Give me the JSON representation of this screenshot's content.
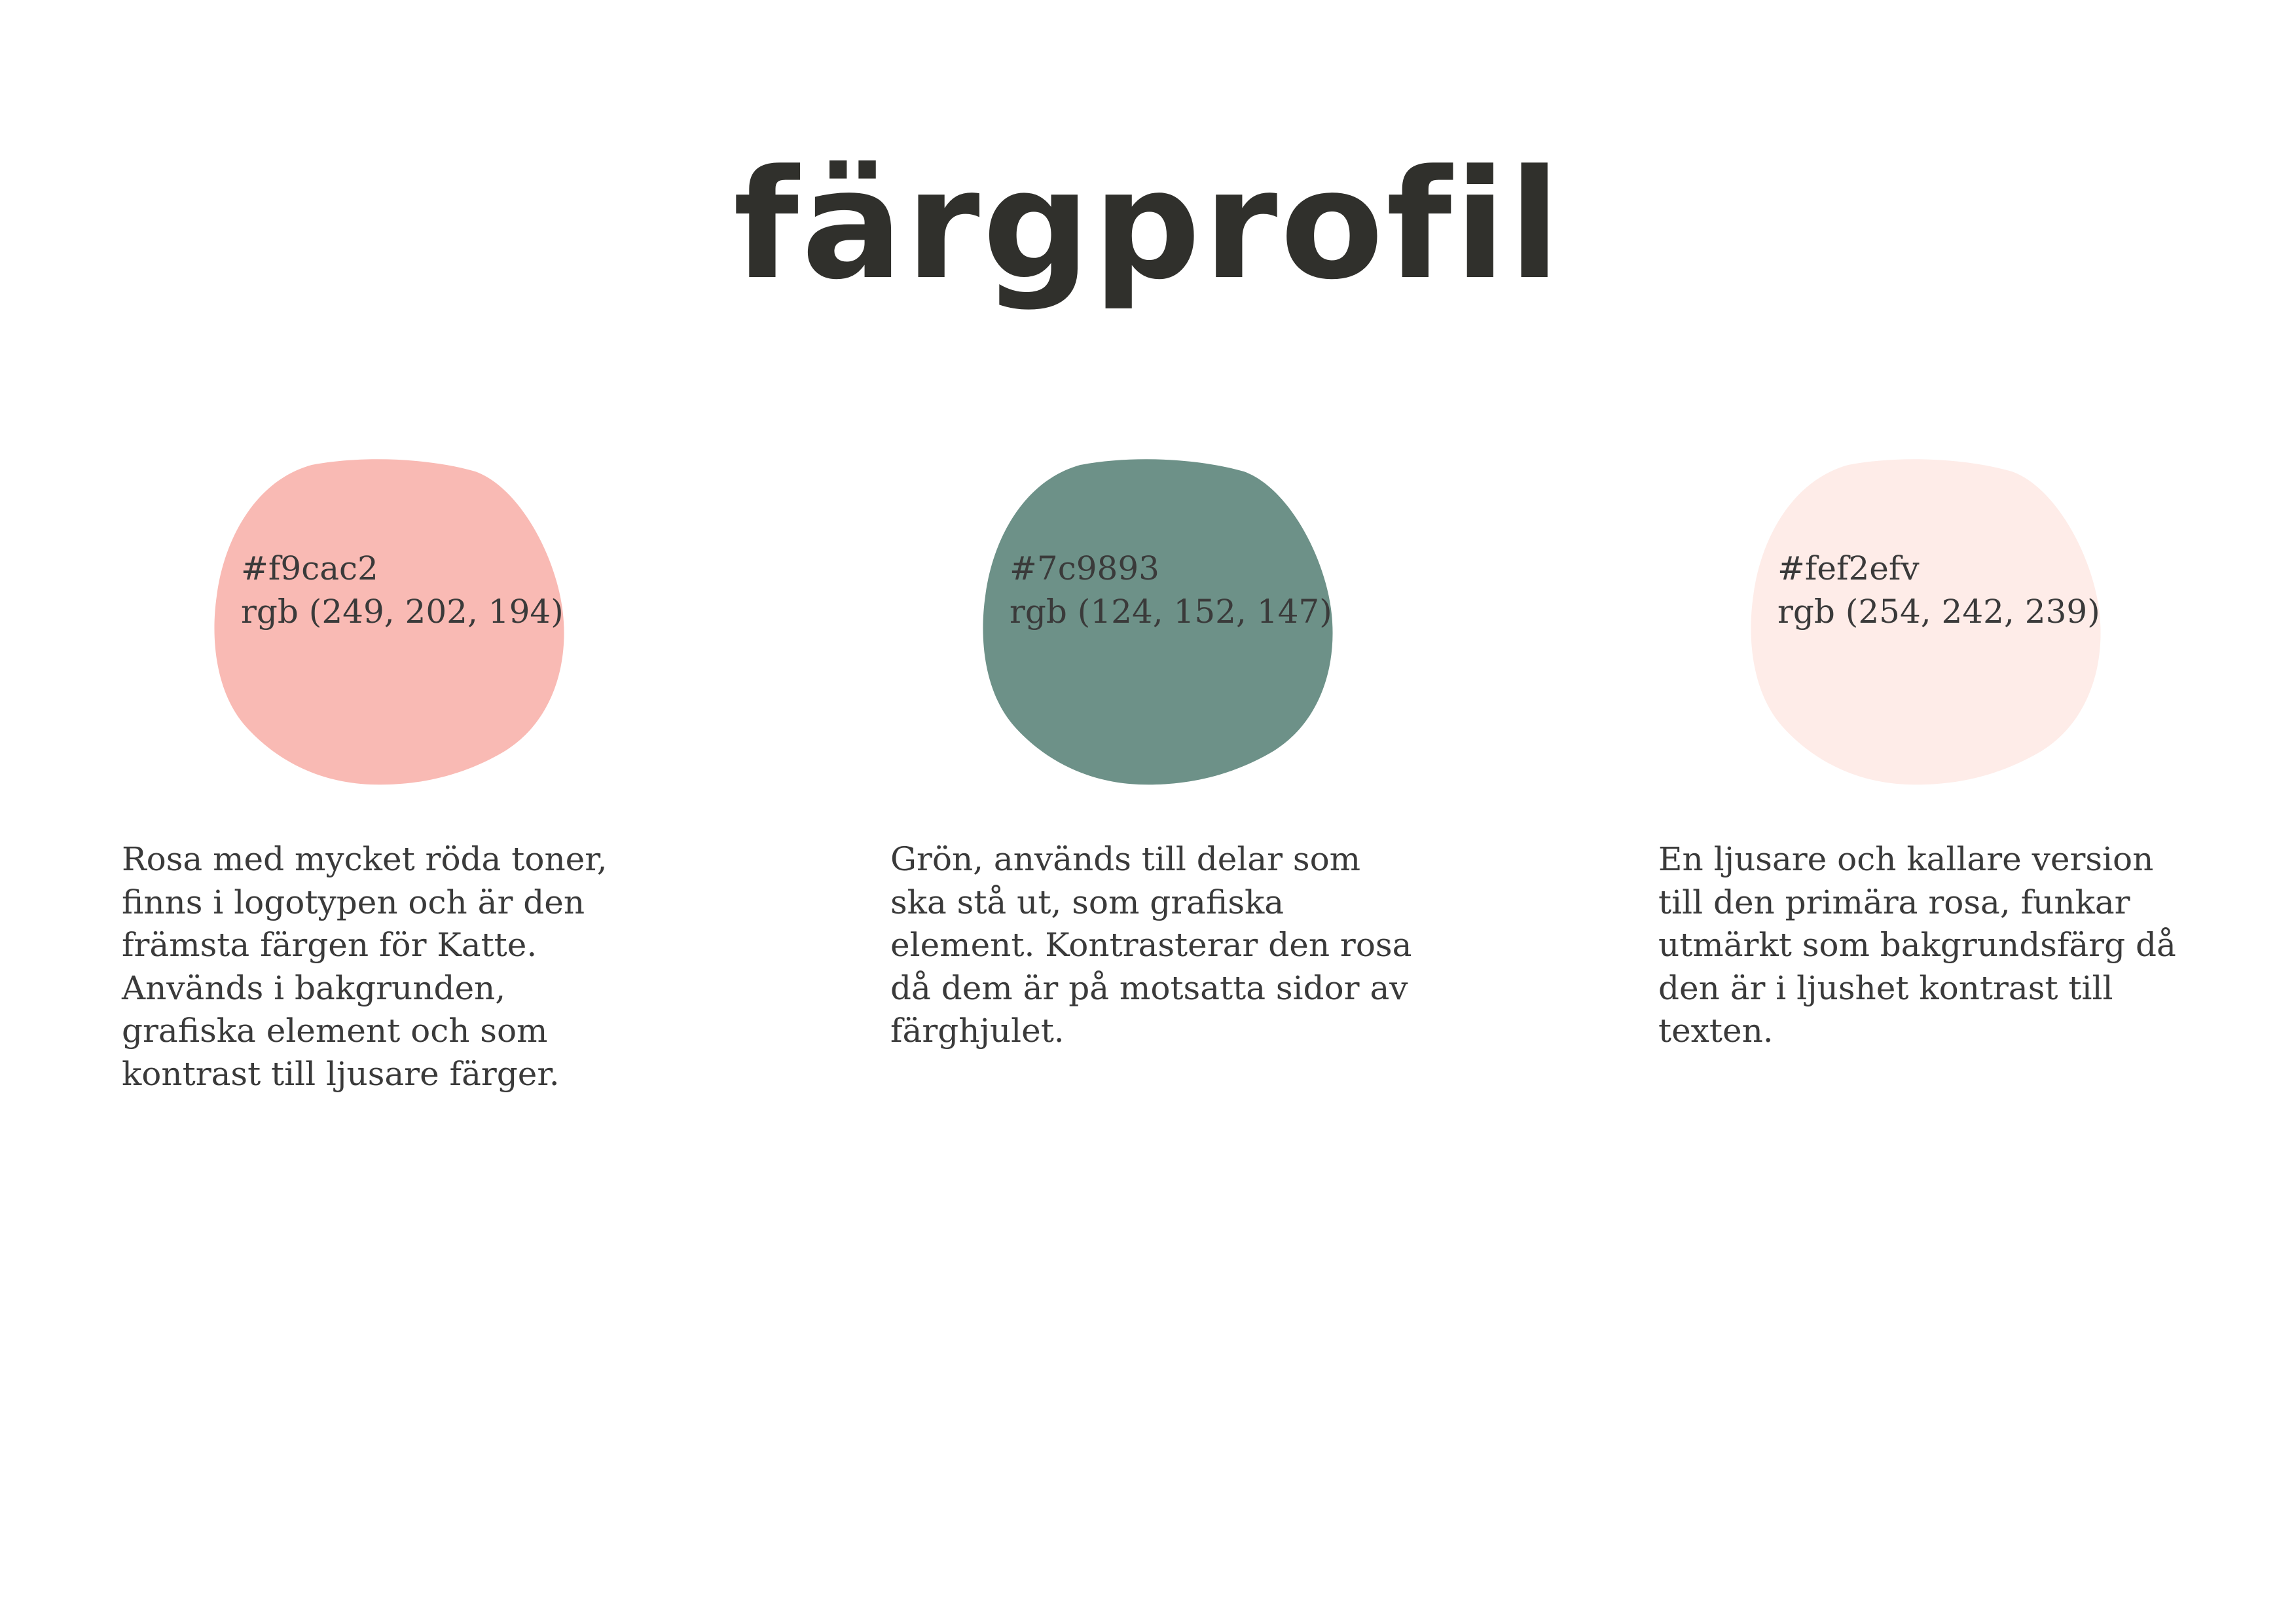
{
  "page": {
    "title": "färgprofil"
  },
  "colors": [
    {
      "hex_label": "#f9cac2",
      "rgb_label": "rgb (249, 202, 194)",
      "fill": "#f9bab4",
      "description": "Rosa med mycket röda toner, finns i logotypen och är den främsta färgen för Katte. Används i bakgrunden, grafiska element och som kontrast till ljusare färger."
    },
    {
      "hex_label": "#7c9893",
      "rgb_label": "rgb (124, 152, 147)",
      "fill": "#6d9188",
      "description": "Grön, används till delar som ska stå ut, som grafiska element. Kontrasterar den rosa då dem är på motsatta sidor av färghjulet."
    },
    {
      "hex_label": "#fef2efv",
      "rgb_label": "rgb (254, 242, 239)",
      "fill": "#feece8",
      "description": "En ljusare och kallare version till den primära rosa, funkar utmärkt som bakgrundsfärg då den är i ljushet kontrast till texten."
    }
  ]
}
